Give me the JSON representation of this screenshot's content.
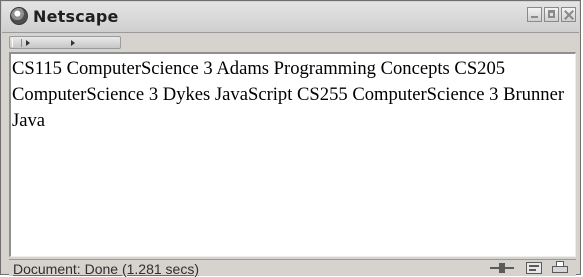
{
  "window": {
    "title": "Netscape"
  },
  "content": {
    "text": "CS115 ComputerScience 3 Adams Programming Concepts CS205 ComputerScience 3 Dykes JavaScript CS255 ComputerScience 3 Brunner Java"
  },
  "statusbar": {
    "text": "Document: Done (1.281 secs)"
  },
  "icons": {
    "app": "netscape-icon",
    "minimize": "minimize-icon",
    "maximize": "maximize-icon",
    "close": "close-icon",
    "connection": "connection-status-icon",
    "security": "security-icon",
    "print": "print-icon"
  }
}
